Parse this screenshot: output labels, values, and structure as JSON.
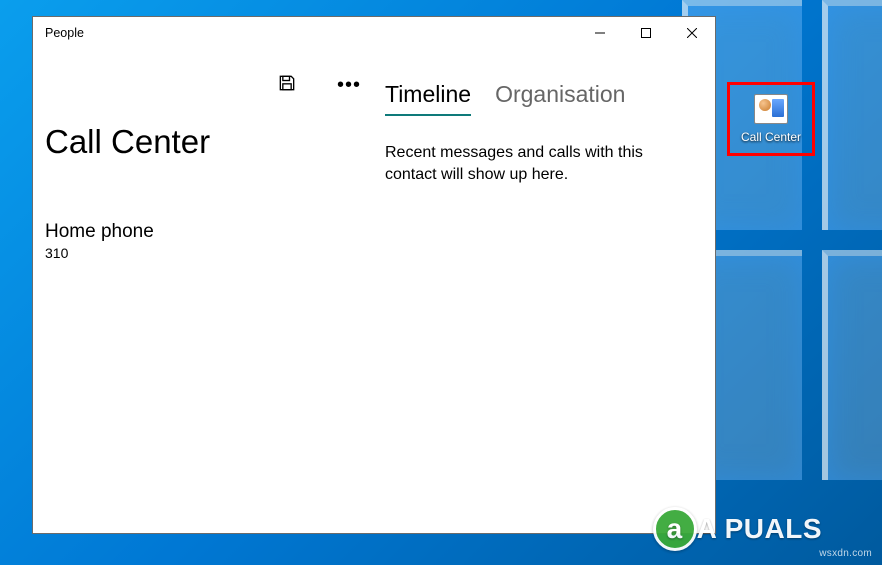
{
  "window": {
    "title": "People"
  },
  "toolbar": {
    "save_label": "Save",
    "more_label": "More"
  },
  "contact": {
    "name": "Call Center",
    "fields": [
      {
        "label": "Home phone",
        "value": "310"
      }
    ]
  },
  "tabs": {
    "timeline": "Timeline",
    "organisation": "Organisation",
    "active": "timeline"
  },
  "timeline": {
    "empty_text": "Recent messages and calls with this contact will show up here."
  },
  "desktop": {
    "icon_label": "Call Center"
  },
  "brand": {
    "name": "A   PUALS"
  },
  "watermark": "wsxdn.com"
}
